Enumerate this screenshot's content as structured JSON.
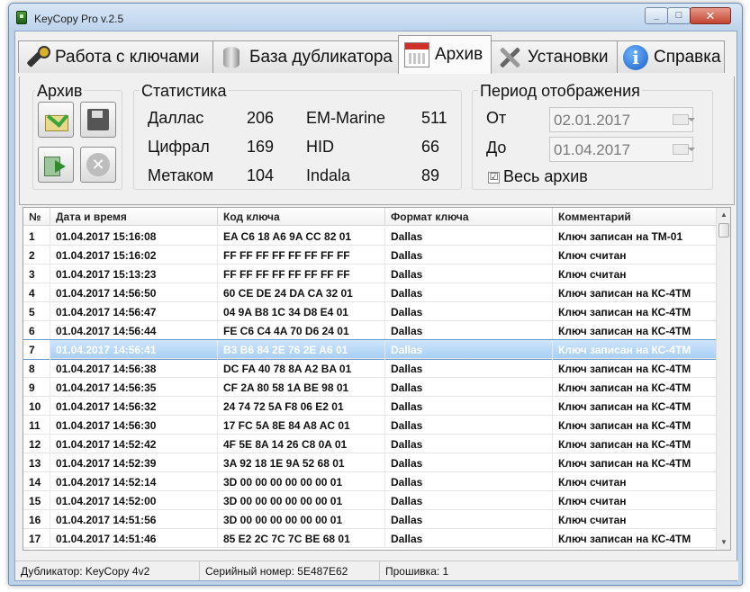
{
  "window": {
    "title": "KeyCopy Pro v.2.5",
    "min": "_",
    "max": "□",
    "close": "✕"
  },
  "tabs": [
    {
      "label": "Работа с ключами",
      "icon": "key-icon"
    },
    {
      "label": "База дубликатора",
      "icon": "database-icon"
    },
    {
      "label": "Архив",
      "icon": "calendar-icon"
    },
    {
      "label": "Установки",
      "icon": "tools-icon"
    },
    {
      "label": "Справка",
      "icon": "info-icon"
    }
  ],
  "archive_group": {
    "title": "Архив"
  },
  "stats_group": {
    "title": "Статистика",
    "items": [
      {
        "name": "Даллас",
        "count": "206"
      },
      {
        "name": "Цифрал",
        "count": "169"
      },
      {
        "name": "Метаком",
        "count": "104"
      },
      {
        "name": "EM-Marine",
        "count": "511"
      },
      {
        "name": "HID",
        "count": "66"
      },
      {
        "name": "Indala",
        "count": "89"
      }
    ]
  },
  "period_group": {
    "title": "Период отображения",
    "from_label": "От",
    "from_value": "02.01.2017",
    "to_label": "До",
    "to_value": "01.04.2017",
    "all_archive_label": "Весь архив",
    "all_archive_checked": "☑"
  },
  "table": {
    "headers": [
      "№",
      "Дата и время",
      "Код ключа",
      "Формат ключа",
      "Комментарий"
    ],
    "selected_row": 7,
    "rows": [
      [
        "1",
        "01.04.2017 15:16:08",
        "EA C6 18 A6 9A CC 82 01",
        "Dallas",
        "Ключ записан на TM-01"
      ],
      [
        "2",
        "01.04.2017 15:16:02",
        "FF FF FF FF FF FF FF FF",
        "Dallas",
        "Ключ считан"
      ],
      [
        "3",
        "01.04.2017 15:13:23",
        "FF FF FF FF FF FF FF FF",
        "Dallas",
        "Ключ считан"
      ],
      [
        "4",
        "01.04.2017 14:56:50",
        "60 CE DE 24 DA CA 32 01",
        "Dallas",
        "Ключ записан на КС-4ТМ"
      ],
      [
        "5",
        "01.04.2017 14:56:47",
        "04 9A B8 1C 34 D8 E4 01",
        "Dallas",
        "Ключ записан на КС-4ТМ"
      ],
      [
        "6",
        "01.04.2017 14:56:44",
        "FE C6 C4 4A 70 D6 24 01",
        "Dallas",
        "Ключ записан на КС-4ТМ"
      ],
      [
        "7",
        "01.04.2017 14:56:41",
        "B3 B6 84 2E 76 2E A6 01",
        "Dallas",
        "Ключ записан на КС-4ТМ"
      ],
      [
        "8",
        "01.04.2017 14:56:38",
        "DC FA 40 78 8A A2 BA 01",
        "Dallas",
        "Ключ записан на КС-4ТМ"
      ],
      [
        "9",
        "01.04.2017 14:56:35",
        "CF 2A 80 58 1A BE 98 01",
        "Dallas",
        "Ключ записан на КС-4ТМ"
      ],
      [
        "10",
        "01.04.2017 14:56:32",
        "24 74 72 5A F8 06 E2 01",
        "Dallas",
        "Ключ записан на КС-4ТМ"
      ],
      [
        "11",
        "01.04.2017 14:56:30",
        "17 FC 5A 8E 84 A8 AC 01",
        "Dallas",
        "Ключ записан на КС-4ТМ"
      ],
      [
        "12",
        "01.04.2017 14:52:42",
        "4F 5E 8A 14 26 C8 0A 01",
        "Dallas",
        "Ключ записан на КС-4ТМ"
      ],
      [
        "13",
        "01.04.2017 14:52:39",
        "3A 92 18 1E 9A 52 68 01",
        "Dallas",
        "Ключ записан на КС-4ТМ"
      ],
      [
        "14",
        "01.04.2017 14:52:14",
        "3D 00 00 00 00 00 00 01",
        "Dallas",
        "Ключ считан"
      ],
      [
        "15",
        "01.04.2017 14:52:00",
        "3D 00 00 00 00 00 00 01",
        "Dallas",
        "Ключ считан"
      ],
      [
        "16",
        "01.04.2017 14:51:56",
        "3D 00 00 00 00 00 00 01",
        "Dallas",
        "Ключ считан"
      ],
      [
        "17",
        "01.04.2017 14:51:46",
        "85 E2 2C 7C 7C BE 68 01",
        "Dallas",
        "Ключ записан на КС-4ТМ"
      ]
    ]
  },
  "statusbar": {
    "duplicator": "Дубликатор: KeyCopy 4v2",
    "serial": "Серийный номер: 5E487E62",
    "firmware": "Прошивка: 1"
  }
}
